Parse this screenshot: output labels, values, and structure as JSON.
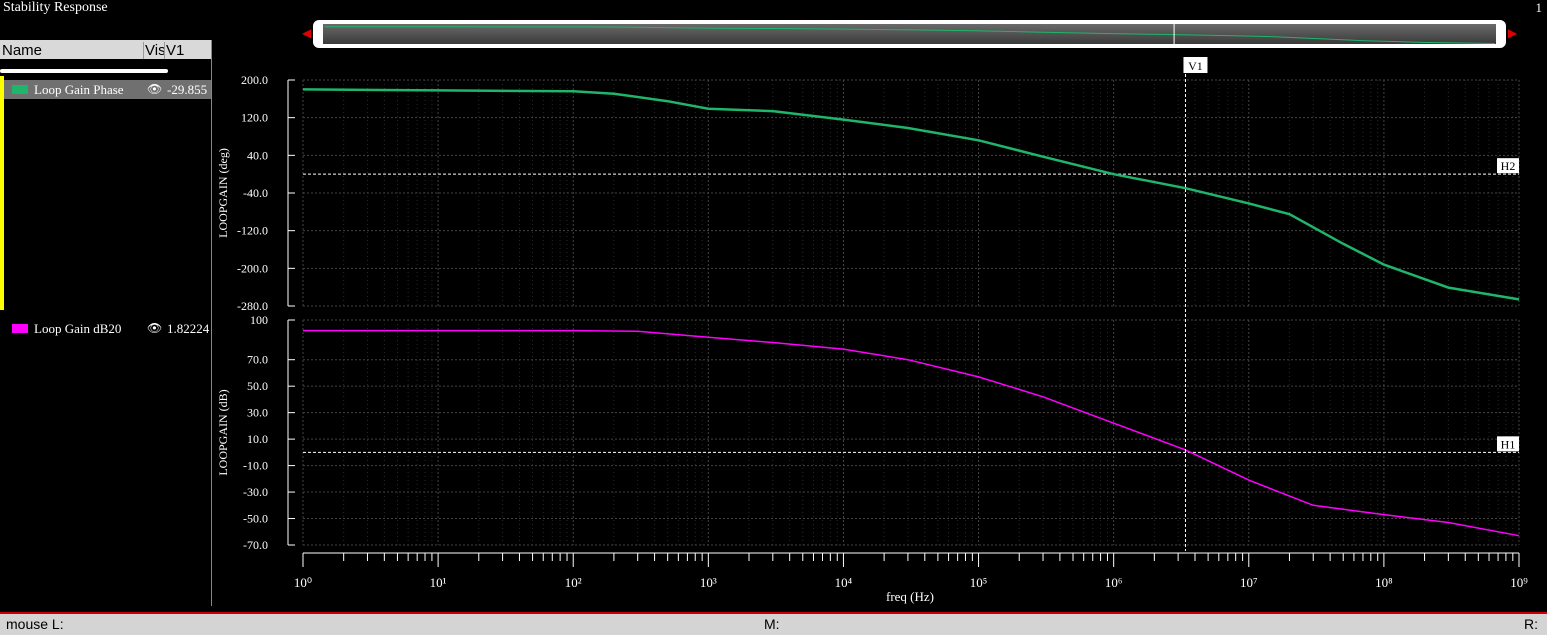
{
  "window": {
    "title": "Stability Response",
    "page": "1"
  },
  "legend": {
    "header": {
      "name": "Name",
      "vis": "Vis",
      "v1": "V1"
    },
    "items": [
      {
        "label": "Loop Gain Phase",
        "value": "-29.855",
        "color": "#1fb56a"
      },
      {
        "label": "Loop Gain dB20",
        "value": "1.82224",
        "color": "#ff00ff"
      }
    ]
  },
  "markers": {
    "vertical": "V1",
    "h_phase": "H2",
    "h_db": "H1"
  },
  "status": {
    "left": "mouse L:",
    "middle": "M:",
    "right": "R:"
  },
  "chart_data": [
    {
      "type": "line",
      "xlabel": "freq (Hz)",
      "ylabel": "LOOPGAIN (deg)",
      "xscale": "log",
      "xlim": [
        1,
        1000000000
      ],
      "ylim": [
        -280,
        200
      ],
      "yticks": [
        "200.0",
        "120.0",
        "40.0",
        "-40.0",
        "-120.0",
        "-200.0",
        "-280.0"
      ],
      "grid": true,
      "series": [
        {
          "name": "Loop Gain Phase",
          "color": "#1fb56a",
          "x": [
            1,
            10,
            100,
            200,
            500,
            1000,
            3000,
            10000,
            30000,
            100000,
            300000,
            1000000,
            3400000,
            10000000,
            20000000,
            50000000,
            100000000,
            300000000,
            1000000000
          ],
          "y": [
            180,
            178,
            176,
            171,
            155,
            139,
            134,
            116,
            98,
            72,
            37,
            0,
            -29.855,
            -62,
            -85,
            -148,
            -192,
            -241,
            -266
          ]
        }
      ],
      "marker_h": 0
    },
    {
      "type": "line",
      "xlabel": "freq (Hz)",
      "ylabel": "LOOPGAIN (dB)",
      "xscale": "log",
      "xlim": [
        1,
        1000000000
      ],
      "ylim": [
        -70,
        100
      ],
      "yticks": [
        "100",
        "70.0",
        "50.0",
        "30.0",
        "10.0",
        "-10.0",
        "-30.0",
        "-50.0",
        "-70.0"
      ],
      "grid": true,
      "series": [
        {
          "name": "Loop Gain dB20",
          "color": "#ff00ff",
          "x": [
            1,
            10,
            100,
            300,
            1000,
            3000,
            10000,
            30000,
            100000,
            300000,
            1000000,
            3400000,
            10000000,
            30000000,
            100000000,
            300000000,
            1000000000
          ],
          "y": [
            92,
            92,
            92,
            91.5,
            87,
            83,
            78,
            70,
            57,
            42,
            22,
            1.82224,
            -21,
            -40,
            -47,
            -53,
            -63
          ]
        }
      ],
      "marker_h": 0
    }
  ],
  "x_marker": 3400000,
  "x_ticks": [
    "10⁰",
    "10¹",
    "10²",
    "10³",
    "10⁴",
    "10⁵",
    "10⁶",
    "10⁷",
    "10⁸",
    "10⁹"
  ]
}
